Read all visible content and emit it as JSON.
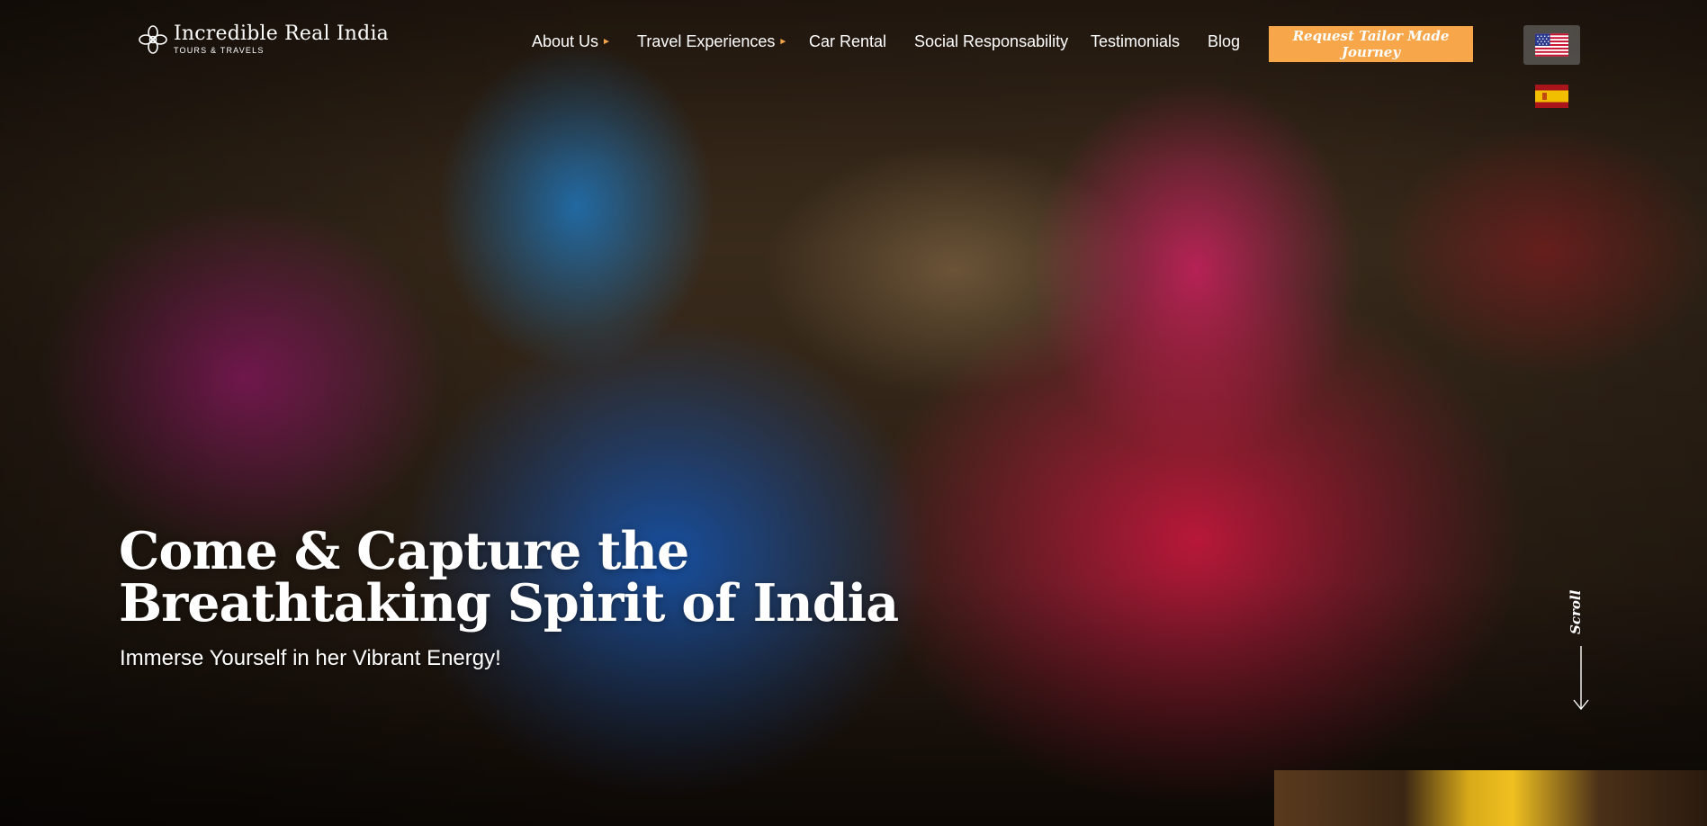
{
  "brand": {
    "name": "Incredible Real India",
    "tagline": "TOURS & TRAVELS",
    "logo_icon": "flower-logo-icon"
  },
  "nav": {
    "items": [
      {
        "label": "About Us",
        "has_dropdown": true
      },
      {
        "label": "Travel Experiences",
        "has_dropdown": true
      },
      {
        "label": "Car Rental",
        "has_dropdown": false
      },
      {
        "label": "Social Responsability",
        "has_dropdown": false
      },
      {
        "label": "Testimonials",
        "has_dropdown": false
      },
      {
        "label": "Blog",
        "has_dropdown": false
      }
    ],
    "cta_label": "Request Tailor Made Journey"
  },
  "languages": [
    {
      "code": "en",
      "icon": "us-flag-icon",
      "selected": true
    },
    {
      "code": "es",
      "icon": "spain-flag-icon",
      "selected": false
    }
  ],
  "hero": {
    "headline_line1": "Come & Capture the",
    "headline_line2": "Breathtaking Spirit of India",
    "subheadline": "Immerse Yourself in her Vibrant Energy!",
    "scroll_label": "Scroll"
  },
  "colors": {
    "accent": "#f7a64a",
    "text": "#ffffff"
  }
}
